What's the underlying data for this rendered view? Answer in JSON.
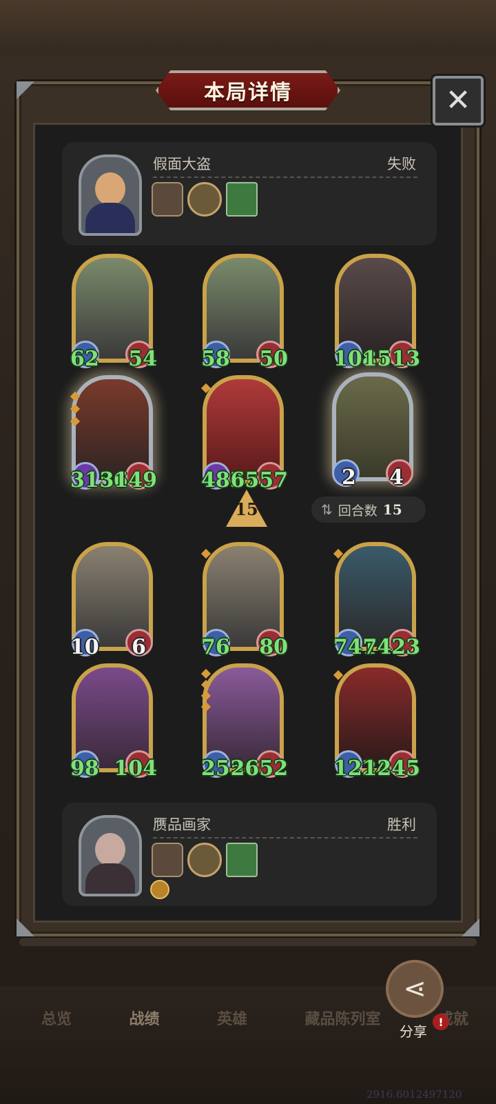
{
  "title": "本局详情",
  "close_label": "✕",
  "top_player": {
    "name": "假面大盗",
    "result": "失败",
    "items": [
      "card",
      "coin",
      "book"
    ]
  },
  "bottom_player": {
    "name": "赝品画家",
    "result": "胜利",
    "items": [
      "card",
      "coin",
      "book"
    ]
  },
  "turn": {
    "arrow_number": "15",
    "label": "回合数",
    "value": "15"
  },
  "opponent_board": [
    {
      "atk": "62",
      "hp": "54"
    },
    {
      "atk": "58",
      "hp": "50"
    },
    {
      "atk": "1081",
      "hp": "1513"
    },
    {
      "atk": "3156",
      "hp": "3149"
    },
    {
      "atk": "4837",
      "hp": "6557"
    },
    {
      "atk": "2",
      "hp": "4"
    }
  ],
  "player_board": [
    {
      "atk": "10",
      "hp": "6"
    },
    {
      "atk": "76",
      "hp": "80"
    },
    {
      "atk": "7414",
      "hp": "7423"
    },
    {
      "atk": "98",
      "hp": "104"
    },
    {
      "atk": "2556",
      "hp": "2652"
    },
    {
      "atk": "1224",
      "hp": "1245"
    }
  ],
  "tabs": [
    "总览",
    "战绩",
    "英雄",
    "藏品陈列室",
    "成就"
  ],
  "active_tab": "战绩",
  "share_label": "分享",
  "share_alert": "!",
  "footer_coords": "2916.6012497120",
  "colors": {
    "stat_green": "#7fe07a",
    "title_red": "#7a1a16",
    "gold_border": "#c9a24a"
  }
}
